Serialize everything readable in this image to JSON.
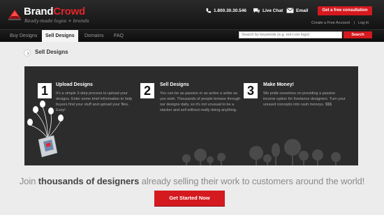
{
  "brand": {
    "name_prefix": "Brand",
    "name_suffix": "Crowd",
    "tagline": "Ready-made logos + brands"
  },
  "header": {
    "phone": "1.800.30.30.546",
    "live_chat": "Live Chat",
    "email": "Email",
    "cta": "Get a free consultation",
    "create_account": "Create a Free Account",
    "separator": "|",
    "login": "Log In"
  },
  "nav": {
    "items": [
      {
        "label": "Buy Designs"
      },
      {
        "label": "Sell Designs"
      },
      {
        "label": "Domains"
      },
      {
        "label": "FAQ"
      }
    ],
    "active": "Sell Designs"
  },
  "search": {
    "placeholder": "Search by keywords (e.g. red Lion logo)",
    "button": "Search"
  },
  "page": {
    "title": "Sell Designs"
  },
  "steps": [
    {
      "number": "1",
      "title": "Upload Designs",
      "desc": "It's a simple 3-step process to upload your designs. Enter some brief information to help buyers find your stuff and upload your files. Easy!"
    },
    {
      "number": "2",
      "title": "Sell Designs",
      "desc": "You can be as passive or as active a seller as you wish. Thousands of people browse through our designs daily, so it's not unusual to be a slacker and sell without really doing anything."
    },
    {
      "number": "3",
      "title": "Make Money!",
      "desc": "We pride ourselves on providing a passive income option for freelance designers. Turn your unused concepts into cash moneys. $$$"
    }
  ],
  "promo": {
    "text_before": "Join ",
    "text_bold": "thousands of designers",
    "text_after": " already selling their work to customers around the world!",
    "cta": "Get Started Now"
  },
  "colors": {
    "accent": "#d4191f",
    "panel": "#2c2c2c",
    "header": "#1a1a1a"
  }
}
